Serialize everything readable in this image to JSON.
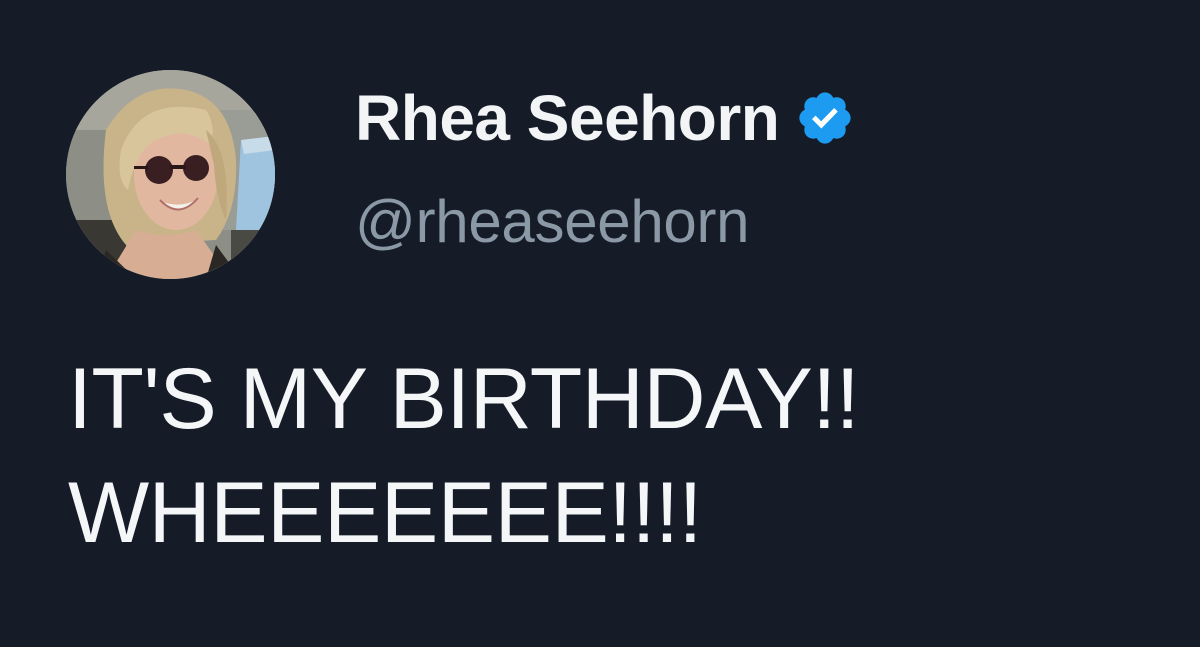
{
  "tweet": {
    "author": {
      "display_name": "Rhea Seehorn",
      "handle": "@rheaseehorn",
      "verified": true,
      "verified_badge_color": "#1d9bf0",
      "avatar_icon": "profile-photo"
    },
    "text_lines": [
      "IT'S MY BIRTHDAY!!",
      "WHEEEEEEE!!!!"
    ]
  },
  "colors": {
    "background": "#151c28",
    "name_text": "#f2f4f6",
    "handle_text": "#8b98a5",
    "body_text": "#f4f6f8"
  }
}
